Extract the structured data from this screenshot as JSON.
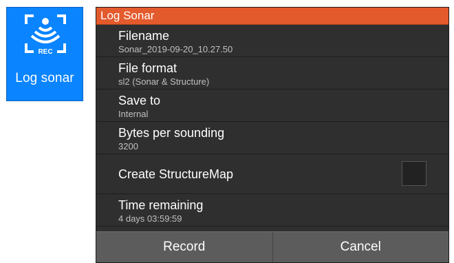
{
  "tile": {
    "label": "Log sonar",
    "icon": "sonar-rec-icon",
    "icon_text": "REC",
    "color": "#0a84ff"
  },
  "dialog": {
    "title": "Log Sonar",
    "title_color": "#e35a2c",
    "rows": [
      {
        "label": "Filename",
        "value": "Sonar_2019-09-20_10.27.50"
      },
      {
        "label": "File format",
        "value": "sl2 (Sonar & Structure)"
      },
      {
        "label": "Save to",
        "value": "Internal"
      },
      {
        "label": "Bytes per sounding",
        "value": "3200"
      },
      {
        "label": "Create StructureMap",
        "checked": false
      },
      {
        "label": "Time remaining",
        "value": "4 days 03:59:59"
      }
    ],
    "buttons": {
      "record": "Record",
      "cancel": "Cancel"
    }
  }
}
